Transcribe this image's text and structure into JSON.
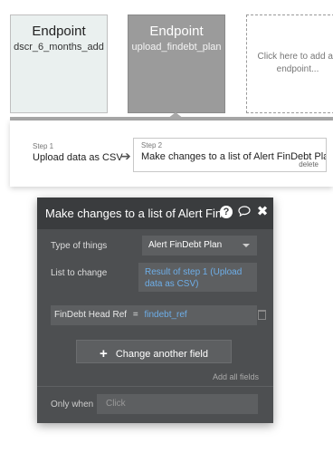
{
  "endpoints": [
    {
      "title": "Endpoint",
      "name": "dscr_6_months_add"
    },
    {
      "title": "Endpoint",
      "name": "upload_findebt_plan"
    }
  ],
  "add_endpoint": {
    "line1": "Click here to add an",
    "line2": "endpoint..."
  },
  "steps": [
    {
      "num": "Step 1",
      "label": "Upload data as CSV"
    },
    {
      "num": "Step 2",
      "label": "Make changes to a list of Alert FinDebt Plans...",
      "delete": "delete"
    }
  ],
  "dialog": {
    "title": "Make changes to a list of Alert Fin",
    "type_label": "Type of things",
    "type_value": "Alert FinDebt Plan",
    "list_label": "List to change",
    "list_value_line1": "Result of step 1 (Upload",
    "list_value_line2": "data as CSV)",
    "change_field": "FinDebt Head Ref",
    "change_eq": "=",
    "change_value": "findebt_ref",
    "change_button": "Change another field",
    "add_all": "Add all fields",
    "only_when_label": "Only when",
    "only_when_placeholder": "Click"
  },
  "icons": {
    "help": "help-icon",
    "comment": "comment-icon",
    "close": "close-icon",
    "trash": "trash-icon"
  }
}
